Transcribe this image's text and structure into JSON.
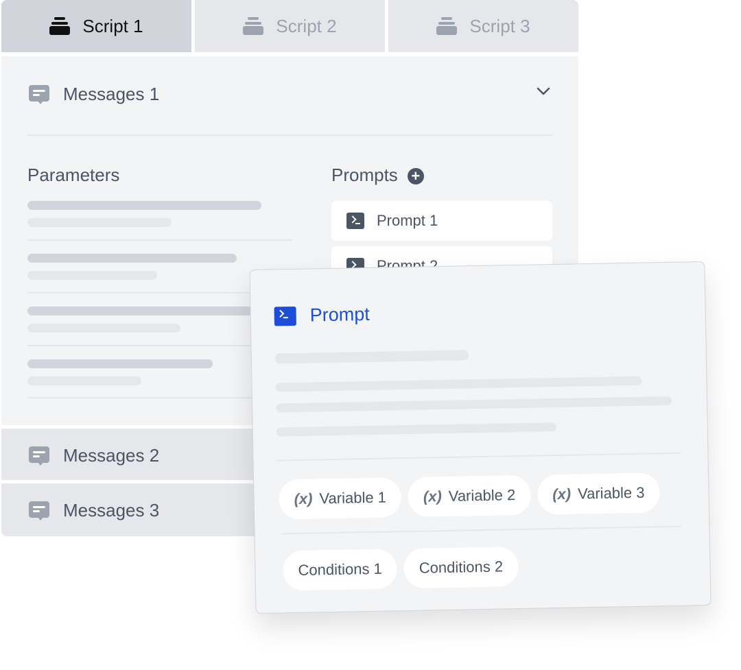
{
  "tabs": [
    {
      "label": "Script 1",
      "active": true
    },
    {
      "label": "Script 2",
      "active": false
    },
    {
      "label": "Script 3",
      "active": false
    }
  ],
  "messages": [
    {
      "label": "Messages 1",
      "expanded": true
    },
    {
      "label": "Messages 2"
    },
    {
      "label": "Messages 3"
    }
  ],
  "parameters": {
    "title": "Parameters"
  },
  "prompts": {
    "title": "Prompts",
    "items": [
      "Prompt 1",
      "Prompt 2"
    ]
  },
  "card": {
    "title": "Prompt",
    "variables": [
      "Variable 1",
      "Variable 2",
      "Variable 3"
    ],
    "variable_prefix": "(x)",
    "conditions": [
      "Conditions 1",
      "Conditions 2"
    ]
  },
  "colors": {
    "accent": "#1d4ed8",
    "panel": "#f3f4f6",
    "tab_active": "#d1d5db"
  }
}
